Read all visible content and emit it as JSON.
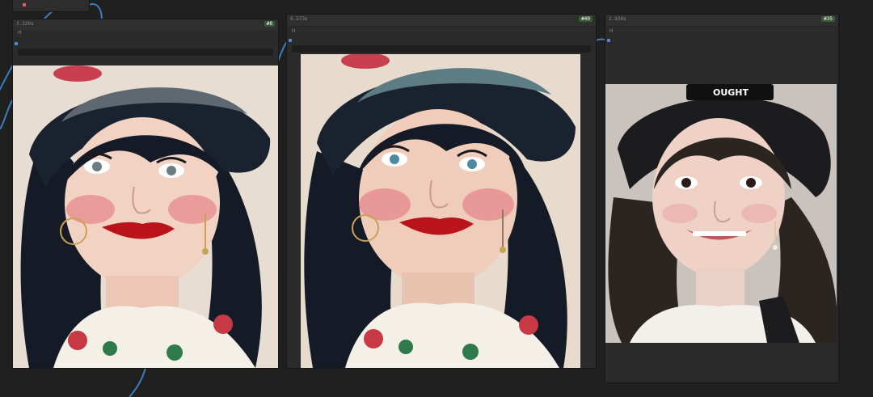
{
  "nodes": [
    {
      "id_label": "#8",
      "time_label": "3.220s",
      "widget_label": "H",
      "image_alt": "Illustrated portrait of a woman with black hair in a gray hat with red flower, rosy cheeks, red lips, gold hoop earrings, floral blouse"
    },
    {
      "id_label": "#40",
      "time_label": "6.573s",
      "widget_label": "H",
      "image_alt": "Watercolor-style illustrated portrait of a woman with black hair in a teal hat with red flower, blush cheeks, red lips, floral collar"
    },
    {
      "id_label": "#35",
      "time_label": "2.938s",
      "widget_label": "H",
      "image_alt": "Photorealistic portrait of a smiling young woman with wavy dark hair wearing a black cap with a white patch, ruffled white top"
    }
  ],
  "cap_patch_text": "OUGHT",
  "colors": {
    "canvas": "#202020",
    "node_body": "#2b2b2b",
    "wire": "#4a90d9",
    "hair": "#141a26",
    "skin": "#f2d2c2",
    "blush": "#e2707a",
    "lips": "#b8141a",
    "hat_gray": "#5f6770",
    "hat_teal": "#5d7c84"
  }
}
